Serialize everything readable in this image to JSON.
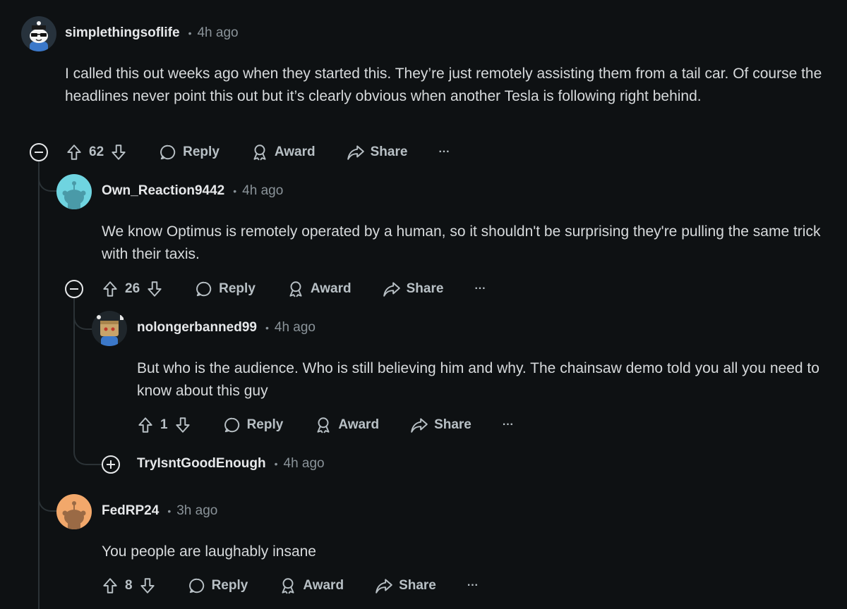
{
  "comments": [
    {
      "username": "simplethingsoflife",
      "time": "4h ago",
      "body": "I called this out weeks ago when they started this. They’re just remotely assisting them from a tail car. Of course the headlines never point this out but it’s clearly obvious when another Tesla is following right behind.",
      "votes": "62",
      "avatar_color": "#2a3a4a"
    },
    {
      "username": "Own_Reaction9442",
      "time": "4h ago",
      "body": "We know Optimus is remotely operated by a human, so it shouldn't be surprising they're pulling the same trick with their taxis.",
      "votes": "26",
      "avatar_color": "#6fd4e0"
    },
    {
      "username": "nolongerbanned99",
      "time": "4h ago",
      "body": "But who is the audience. Who is still believing him and why. The chainsaw demo told you all you need to know about this guy",
      "votes": "1",
      "avatar_color": "#e7e2d6"
    },
    {
      "username": "TryIsntGoodEnough",
      "time": "4h ago"
    },
    {
      "username": "FedRP24",
      "time": "3h ago",
      "body": "You people are laughably insane",
      "votes": "8",
      "avatar_color": "#f2a86b"
    }
  ],
  "actions": {
    "reply": "Reply",
    "award": "Award",
    "share": "Share",
    "more": "···"
  },
  "icons": {
    "upvote": "upvote-arrow-icon",
    "downvote": "downvote-arrow-icon",
    "reply": "speech-bubble-icon",
    "award": "award-ribbon-icon",
    "share": "share-arrow-icon",
    "collapse": "minus-circle-icon",
    "expand": "plus-circle-icon"
  },
  "colors": {
    "background": "#0e1113",
    "text": "#d7dadc",
    "muted": "#8a9399",
    "thread_line": "#2b3236"
  }
}
